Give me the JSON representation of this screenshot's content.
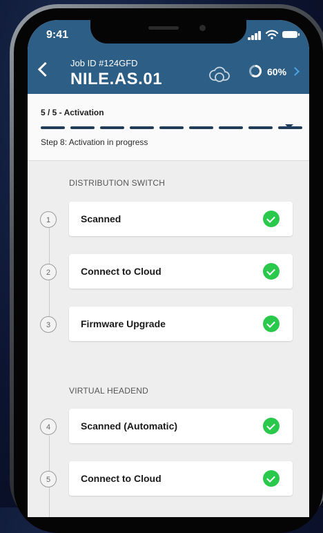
{
  "status_bar": {
    "time": "9:41"
  },
  "header": {
    "job_id": "Job ID #124GFD",
    "job_name": "NILE.AS.01",
    "progress_percent": 60,
    "progress_label": "60%",
    "accent_color": "#2d5e86",
    "icons": [
      "back-chevron-icon",
      "cloud-sync-icon",
      "progress-ring-icon",
      "chevron-right-icon"
    ]
  },
  "stage": {
    "title": "5 / 5 - Activation",
    "subtitle": "Step 8: Activation in progress",
    "total_steps": 9,
    "dash_color": "#1f3d5b"
  },
  "sections": [
    {
      "label": "DISTRIBUTION SWITCH",
      "steps": [
        {
          "number": "1",
          "label": "Scanned",
          "status": "complete"
        },
        {
          "number": "2",
          "label": "Connect to Cloud",
          "status": "complete"
        },
        {
          "number": "3",
          "label": "Firmware Upgrade",
          "status": "complete"
        }
      ]
    },
    {
      "label": "VIRTUAL HEADEND",
      "steps": [
        {
          "number": "4",
          "label": "Scanned (Automatic)",
          "status": "complete"
        },
        {
          "number": "5",
          "label": "Connect to Cloud",
          "status": "complete"
        }
      ]
    }
  ],
  "status_colors": {
    "complete": "#2ac94c"
  }
}
